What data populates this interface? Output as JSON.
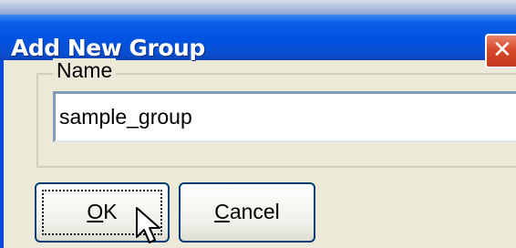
{
  "dialog": {
    "title": "Add New Group",
    "close_icon": "close-icon"
  },
  "group": {
    "legend": "Name",
    "input_value": "sample_group"
  },
  "buttons": {
    "ok_mnemonic": "O",
    "ok_rest": "K",
    "cancel_mnemonic": "C",
    "cancel_rest": "ancel"
  },
  "cursor": "arrow-pointer-icon"
}
